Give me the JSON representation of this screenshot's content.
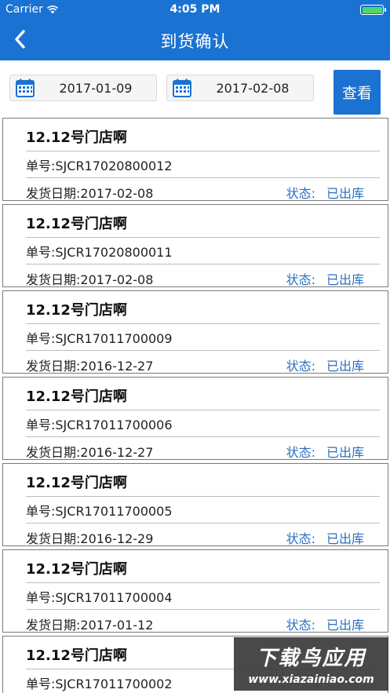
{
  "status_bar": {
    "carrier": "Carrier",
    "time": "4:05 PM"
  },
  "nav": {
    "title": "到货确认"
  },
  "filter": {
    "start_date": "2017-01-09",
    "end_date": "2017-02-08",
    "query_label": "查看"
  },
  "orders": [
    {
      "shop": "12.12号门店啊",
      "order_no": "单号:SJCR17020800012",
      "ship_date": "发货日期:2017-02-08",
      "status_label": "状态:",
      "status_value": "已出库"
    },
    {
      "shop": "12.12号门店啊",
      "order_no": "单号:SJCR17020800011",
      "ship_date": "发货日期:2017-02-08",
      "status_label": "状态:",
      "status_value": "已出库"
    },
    {
      "shop": "12.12号门店啊",
      "order_no": "单号:SJCR17011700009",
      "ship_date": "发货日期:2016-12-27",
      "status_label": "状态:",
      "status_value": "已出库"
    },
    {
      "shop": "12.12号门店啊",
      "order_no": "单号:SJCR17011700006",
      "ship_date": "发货日期:2016-12-27",
      "status_label": "状态:",
      "status_value": "已出库"
    },
    {
      "shop": "12.12号门店啊",
      "order_no": "单号:SJCR17011700005",
      "ship_date": "发货日期:2016-12-29",
      "status_label": "状态:",
      "status_value": "已出库"
    },
    {
      "shop": "12.12号门店啊",
      "order_no": "单号:SJCR17011700004",
      "ship_date": "发货日期:2017-01-12",
      "status_label": "状态:",
      "status_value": "已出库"
    },
    {
      "shop": "12.12号门店啊",
      "order_no": "单号:SJCR17011700002",
      "ship_date": "",
      "status_label": "",
      "status_value": ""
    }
  ],
  "watermark": {
    "line1": "下载鸟应用",
    "line2": "www.xiazainiao.com"
  },
  "colors": {
    "brand_blue": "#1a72d2",
    "status_blue": "#2a6fc0",
    "battery_green": "#4cd964"
  },
  "icons": {
    "back": "chevron-left-icon",
    "calendar": "calendar-icon",
    "wifi": "wifi-icon",
    "battery": "battery-icon"
  }
}
